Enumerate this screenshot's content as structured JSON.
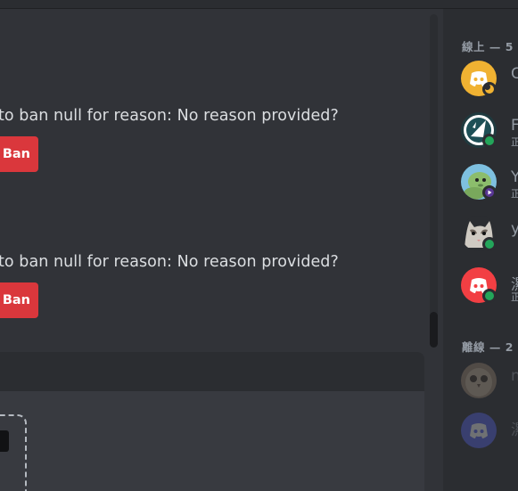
{
  "messages": [
    {
      "text": "to ban null for reason: No reason provided?",
      "button_label": "Ban"
    },
    {
      "text": "to ban null for reason: No reason provided?",
      "button_label": "Ban"
    }
  ],
  "members": {
    "online_header": "線上 — 5",
    "offline_header": "離線 — 2",
    "online": [
      {
        "name": "C",
        "subtitle": "",
        "avatar": "discord-logo-orange",
        "status": "idle"
      },
      {
        "name": "F",
        "subtitle": "正",
        "avatar": "bird-logo",
        "status": "online"
      },
      {
        "name": "Y",
        "subtitle": "正",
        "avatar": "green-creature",
        "status": "streaming"
      },
      {
        "name": "y",
        "subtitle": "",
        "avatar": "cat-photo",
        "status": "online"
      },
      {
        "name": "濕",
        "subtitle": "正",
        "avatar": "discord-logo-red",
        "status": "online"
      }
    ],
    "offline": [
      {
        "name": "n",
        "subtitle": "",
        "avatar": "owl-photo"
      },
      {
        "name": "濕",
        "subtitle": "",
        "avatar": "discord-logo-blurple"
      }
    ]
  },
  "colors": {
    "chat_bg": "#313338",
    "sidebar_bg": "#2b2d31",
    "ban_button": "#da373c",
    "online": "#23a55a",
    "idle": "#f0b232",
    "streaming": "#593695",
    "discord_orange": "#f0b232",
    "discord_red": "#f23f43",
    "discord_blurple": "#5865f2"
  }
}
